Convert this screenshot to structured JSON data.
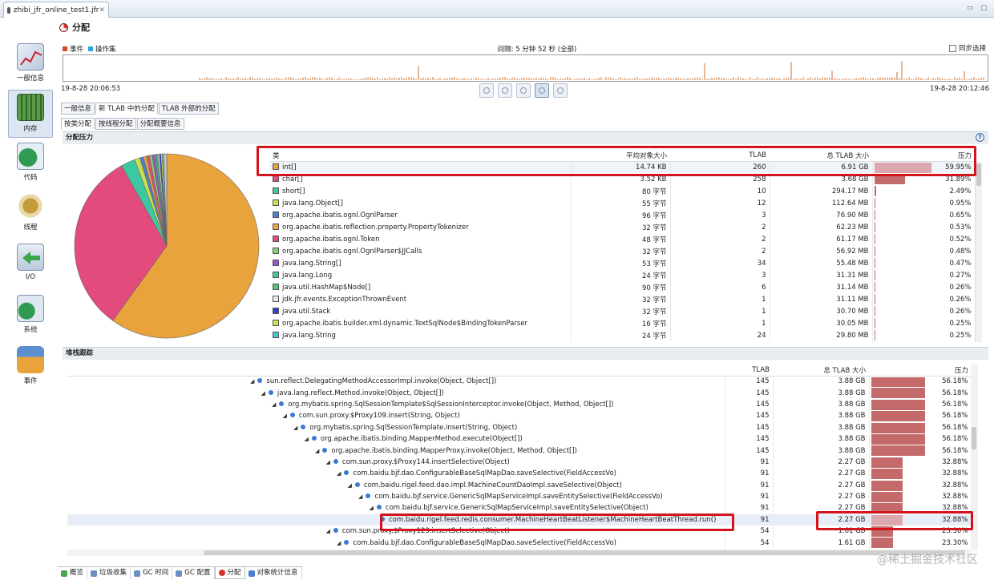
{
  "editor_tab": {
    "title": "zhibi_jfr_online_test1.jfr"
  },
  "nav": [
    {
      "label": "一般信息",
      "icon": "chart-gauge-icon"
    },
    {
      "label": "内存",
      "icon": "memory-chip-icon"
    },
    {
      "label": "代码",
      "icon": "code-icon"
    },
    {
      "label": "线程",
      "icon": "threads-gear-icon"
    },
    {
      "label": "I/O",
      "icon": "io-icon"
    },
    {
      "label": "系统",
      "icon": "system-icon"
    },
    {
      "label": "事件",
      "icon": "events-icon"
    }
  ],
  "page": {
    "title": "分配"
  },
  "timeline": {
    "legend": [
      {
        "label": "事件",
        "color": "#d24b2c"
      },
      {
        "label": "操作集",
        "color": "#2aa6d8"
      }
    ],
    "range": "间隔: 5 分钟 52 秒 (全部)",
    "sync_label": "同步选择",
    "start": "19-8-28 20:06:53",
    "end": "19-8-28 20:12:46"
  },
  "tabs1": [
    "一般信息",
    "新 TLAB 中的分配",
    "TLAB 外部的分配"
  ],
  "tabs2": [
    "按类分配",
    "按线程分配",
    "分配概要信息"
  ],
  "alloc": {
    "section_title": "分配压力",
    "help": "?",
    "columns": [
      "类",
      "平均对象大小",
      "TLAB",
      "总 TLAB 大小",
      "压力"
    ],
    "rows": [
      {
        "cls": "int[]",
        "avg": "14.74 KB",
        "tlab": "260",
        "total": "6.91 GB",
        "pressure": "59.95%",
        "p": 59.95,
        "color": "#e8a33c"
      },
      {
        "cls": "char[]",
        "avg": "3.52 KB",
        "tlab": "258",
        "total": "3.68 GB",
        "pressure": "31.89%",
        "p": 31.89,
        "color": "#e34b7d"
      },
      {
        "cls": "short[]",
        "avg": "80 字节",
        "tlab": "10",
        "total": "294.17 MB",
        "pressure": "2.49%",
        "p": 2.49,
        "color": "#3cc8a4"
      },
      {
        "cls": "java.lang.Object[]",
        "avg": "55 字节",
        "tlab": "12",
        "total": "112.64 MB",
        "pressure": "0.95%",
        "p": 0.95,
        "color": "#c9e04a"
      },
      {
        "cls": "org.apache.ibatis.ognl.OgnlParser",
        "avg": "96 字节",
        "tlab": "3",
        "total": "76.90 MB",
        "pressure": "0.65%",
        "p": 0.65,
        "color": "#4a7fd1"
      },
      {
        "cls": "org.apache.ibatis.reflection.property.PropertyTokenizer",
        "avg": "32 字节",
        "tlab": "2",
        "total": "62.23 MB",
        "pressure": "0.53%",
        "p": 0.53,
        "color": "#e8a33c"
      },
      {
        "cls": "org.apache.ibatis.ognl.Token",
        "avg": "48 字节",
        "tlab": "2",
        "total": "61.17 MB",
        "pressure": "0.52%",
        "p": 0.52,
        "color": "#e34b7d"
      },
      {
        "cls": "org.apache.ibatis.ognl.OgnlParser$JJCalls",
        "avg": "32 字节",
        "tlab": "2",
        "total": "56.92 MB",
        "pressure": "0.48%",
        "p": 0.48,
        "color": "#7fd36a"
      },
      {
        "cls": "java.lang.String[]",
        "avg": "53 字节",
        "tlab": "34",
        "total": "55.48 MB",
        "pressure": "0.47%",
        "p": 0.47,
        "color": "#a34fd1"
      },
      {
        "cls": "java.lang.Long",
        "avg": "24 字节",
        "tlab": "3",
        "total": "31.31 MB",
        "pressure": "0.27%",
        "p": 0.27,
        "color": "#3cc8a4"
      },
      {
        "cls": "java.util.HashMap$Node[]",
        "avg": "90 字节",
        "tlab": "6",
        "total": "31.14 MB",
        "pressure": "0.26%",
        "p": 0.26,
        "color": "#52c76b"
      },
      {
        "cls": "jdk.jfr.events.ExceptionThrownEvent",
        "avg": "32 字节",
        "tlab": "1",
        "total": "31.11 MB",
        "pressure": "0.26%",
        "p": 0.26,
        "color": "#e8e8e8"
      },
      {
        "cls": "java.util.Stack",
        "avg": "32 字节",
        "tlab": "1",
        "total": "30.70 MB",
        "pressure": "0.26%",
        "p": 0.26,
        "color": "#3a3fc9"
      },
      {
        "cls": "org.apache.ibatis.builder.xml.dynamic.TextSqlNode$BindingTokenParser",
        "avg": "16 字节",
        "tlab": "1",
        "total": "30.05 MB",
        "pressure": "0.25%",
        "p": 0.25,
        "color": "#c9e04a"
      },
      {
        "cls": "java.lang.String",
        "avg": "24 字节",
        "tlab": "24",
        "total": "29.80 MB",
        "pressure": "0.25%",
        "p": 0.25,
        "color": "#3cc8d8"
      }
    ]
  },
  "stack": {
    "section_title": "堆栈跟踪",
    "columns": [
      "",
      "TLAB",
      "总 TLAB 大小",
      "压力"
    ],
    "rows": [
      {
        "indent": 0,
        "frame": "sun.reflect.DelegatingMethodAccessorImpl.invoke(Object, Object[])",
        "tlab": "145",
        "total": "3.88 GB",
        "pressure": "56.18%",
        "p": 56.18
      },
      {
        "indent": 1,
        "frame": "java.lang.reflect.Method.invoke(Object, Object[])",
        "tlab": "145",
        "total": "3.88 GB",
        "pressure": "56.18%",
        "p": 56.18
      },
      {
        "indent": 2,
        "frame": "org.mybatis.spring.SqlSessionTemplate$SqlSessionInterceptor.invoke(Object, Method, Object[])",
        "tlab": "145",
        "total": "3.88 GB",
        "pressure": "56.18%",
        "p": 56.18
      },
      {
        "indent": 3,
        "frame": "com.sun.proxy.$Proxy109.insert(String, Object)",
        "tlab": "145",
        "total": "3.88 GB",
        "pressure": "56.18%",
        "p": 56.18
      },
      {
        "indent": 4,
        "frame": "org.mybatis.spring.SqlSessionTemplate.insert(String, Object)",
        "tlab": "145",
        "total": "3.88 GB",
        "pressure": "56.18%",
        "p": 56.18
      },
      {
        "indent": 5,
        "frame": "org.apache.ibatis.binding.MapperMethod.execute(Object[])",
        "tlab": "145",
        "total": "3.88 GB",
        "pressure": "56.18%",
        "p": 56.18
      },
      {
        "indent": 6,
        "frame": "org.apache.ibatis.binding.MapperProxy.invoke(Object, Method, Object[])",
        "tlab": "145",
        "total": "3.88 GB",
        "pressure": "56.18%",
        "p": 56.18
      },
      {
        "indent": 7,
        "frame": "com.sun.proxy.$Proxy144.insertSelective(Object)",
        "tlab": "91",
        "total": "2.27 GB",
        "pressure": "32.88%",
        "p": 32.88
      },
      {
        "indent": 8,
        "frame": "com.baidu.bjf.dao.ConfigurableBaseSqlMapDao.saveSelective(FieldAccessVo)",
        "tlab": "91",
        "total": "2.27 GB",
        "pressure": "32.88%",
        "p": 32.88
      },
      {
        "indent": 9,
        "frame": "com.baidu.rigel.feed.dao.impl.MachineCountDaoImpl.saveSelective(Object)",
        "tlab": "91",
        "total": "2.27 GB",
        "pressure": "32.88%",
        "p": 32.88
      },
      {
        "indent": 10,
        "frame": "com.baidu.bjf.service.GenericSqlMapServiceImpl.saveEntitySelective(FieldAccessVo)",
        "tlab": "91",
        "total": "2.27 GB",
        "pressure": "32.88%",
        "p": 32.88
      },
      {
        "indent": 11,
        "frame": "com.baidu.bjf.service.GenericSqlMapServiceImpl.saveEntitySelective(Object)",
        "tlab": "91",
        "total": "2.27 GB",
        "pressure": "32.88%",
        "p": 32.88
      },
      {
        "indent": 12,
        "frame": "com.baidu.rigel.feed.redis.consumer.MachineHeartBeatListener$MachineHeartBeatThread.run()",
        "tlab": "91",
        "total": "2.27 GB",
        "pressure": "32.88%",
        "p": 32.88,
        "selected": true
      },
      {
        "indent": 7,
        "frame": "com.sun.proxy.$Proxy123.insertSelective(Object)",
        "tlab": "54",
        "total": "1.61 GB",
        "pressure": "23.30%",
        "p": 23.3
      },
      {
        "indent": 8,
        "frame": "com.baidu.bjf.dao.ConfigurableBaseSqlMapDao.saveSelective(FieldAccessVo)",
        "tlab": "54",
        "total": "1.61 GB",
        "pressure": "23.30%",
        "p": 23.3
      }
    ]
  },
  "bottom_tabs": [
    {
      "label": "概览",
      "color": "#4aa64a"
    },
    {
      "label": "垃圾收集",
      "color": "#6a8fc0"
    },
    {
      "label": "GC 时间",
      "color": "#6a8fc0"
    },
    {
      "label": "GC 配置",
      "color": "#6a8fc0"
    },
    {
      "label": "分配",
      "color": "#d62f2f"
    },
    {
      "label": "对象统计信息",
      "color": "#4a7fd1"
    }
  ],
  "watermark": "@稀土掘金技术社区"
}
